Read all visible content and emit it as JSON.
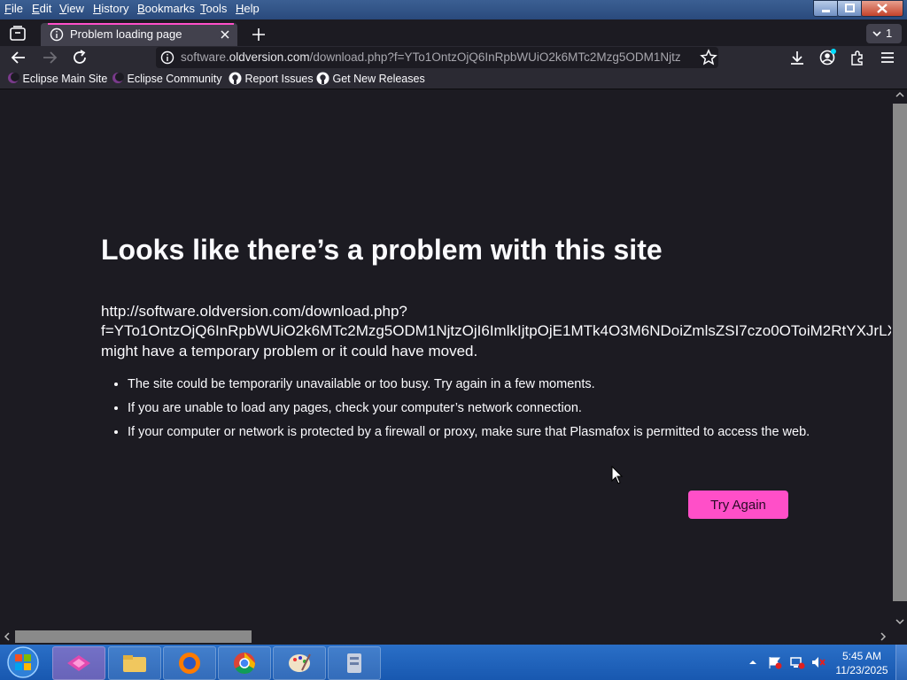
{
  "menu": [
    {
      "label": "File",
      "hotkey": "F",
      "rest": "ile"
    },
    {
      "label": "Edit",
      "hotkey": "E",
      "rest": "dit"
    },
    {
      "label": "View",
      "hotkey": "V",
      "rest": "iew"
    },
    {
      "label": "History",
      "hotkey": "H",
      "rest": "istory"
    },
    {
      "label": "Bookmarks",
      "hotkey": "B",
      "rest": "ookmarks"
    },
    {
      "label": "Tools",
      "hotkey": "T",
      "rest": "ools"
    },
    {
      "label": "Help",
      "hotkey": "H",
      "rest": "elp"
    }
  ],
  "tab": {
    "title": "Problem loading page",
    "tab_count": "1"
  },
  "url": {
    "host_prefix": "software.",
    "host": "oldversion.com",
    "path": "/download.php?f=YTo1OntzOjQ6InRpbWUiO2k6MTc2Mzg5ODM1Njtz"
  },
  "bookmarks": [
    "Eclipse Main Site",
    "Eclipse Community",
    "Report Issues",
    "Get New Releases"
  ],
  "error": {
    "title": "Looks like there’s a problem with this site",
    "url_line1": "http://software.oldversion.com/download.php?",
    "url_line2": "f=YTo1OntzOjQ6InRpbWUiO2k6MTc2Mzg5ODM1NjtzOjI6ImlkIjtpOjE1MTk4O3M6NDoiZmlsZSI7czo0OToiM2RtYXJrLX",
    "url_line3": "might have a temporary problem or it could have moved.",
    "reasons": [
      "The site could be temporarily unavailable or too busy. Try again in a few moments.",
      "If you are unable to load any pages, check your computer’s network connection.",
      "If your computer or network is protected by a firewall or proxy, make sure that Plasmafox is permitted to access the web."
    ],
    "button": "Try Again"
  },
  "clock": {
    "time": "5:45 AM",
    "date": "11/23/2025"
  },
  "colors": {
    "accent": "#ff4fc8",
    "background": "#1c1b22",
    "toolbar": "#2b2a33"
  },
  "icons": [
    "back-arrow-icon",
    "forward-arrow-icon",
    "reload-icon",
    "info-icon",
    "star-icon",
    "download-icon",
    "account-icon",
    "extensions-icon",
    "hamburger-menu-icon"
  ]
}
